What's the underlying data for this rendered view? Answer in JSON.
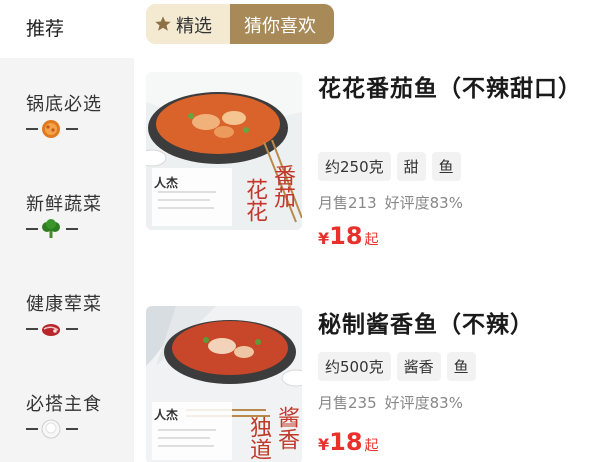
{
  "sidebar": {
    "recommend": "推荐",
    "categories": [
      {
        "label": "锅底必选",
        "icon": "hotpot-icon"
      },
      {
        "label": "新鲜蔬菜",
        "icon": "broccoli-icon"
      },
      {
        "label": "健康荤菜",
        "icon": "steak-icon"
      },
      {
        "label": "必搭主食",
        "icon": "rice-icon"
      }
    ]
  },
  "tabs": {
    "selected": "精选",
    "other": "猜你喜欢"
  },
  "products": [
    {
      "title": "花花番茄鱼（不辣甜口）",
      "tags": [
        "约250克",
        "甜",
        "鱼"
      ],
      "sales": "月售213",
      "rating": "好评度83%",
      "currency": "¥",
      "price": "18",
      "price_suffix": "起",
      "thumb_text_1": "花花",
      "thumb_text_2": "番茄",
      "thumb_brand": "人杰"
    },
    {
      "title": "秘制酱香鱼（不辣）",
      "tags": [
        "约500克",
        "酱香",
        "鱼"
      ],
      "sales": "月售235",
      "rating": "好评度83%",
      "currency": "¥",
      "price": "18",
      "price_suffix": "起",
      "thumb_text_1": "独道",
      "thumb_text_2": "酱香",
      "thumb_brand": "人杰"
    }
  ],
  "colors": {
    "price": "#e8312b",
    "tab_active_bg": "#f4ead2",
    "tab_inactive_bg": "#a88a58",
    "sidebar_bg": "#f4f4f4"
  }
}
